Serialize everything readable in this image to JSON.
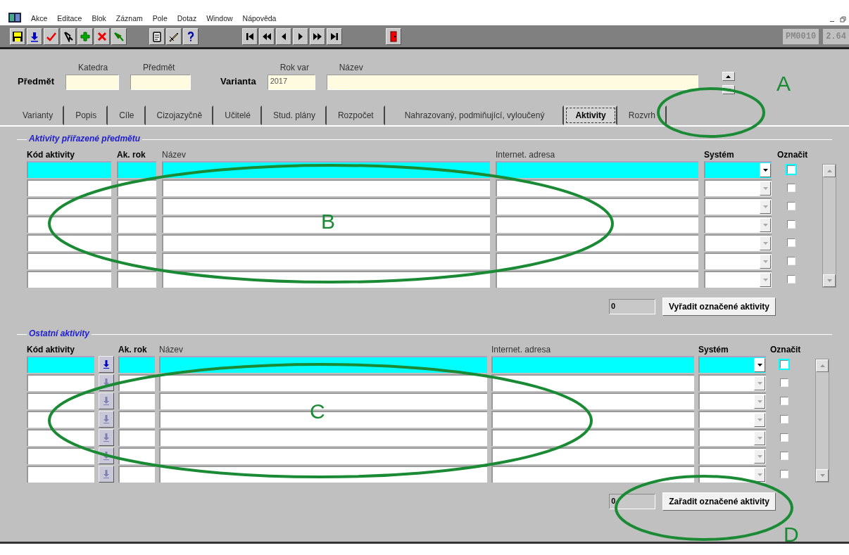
{
  "menu": [
    "Akce",
    "Editace",
    "Blok",
    "Záznam",
    "Pole",
    "Dotaz",
    "Window",
    "Nápověda"
  ],
  "toolbar": {
    "form_id": "PM0010",
    "version": "2.64"
  },
  "header": {
    "groups": [
      {
        "label": "Předmět",
        "fields": [
          {
            "label": "Katedra"
          },
          {
            "label": "Předmět"
          }
        ]
      },
      {
        "label": "Varianta",
        "fields": [
          {
            "label": "Rok var",
            "value": "2017"
          },
          {
            "label": "Název"
          }
        ]
      }
    ]
  },
  "tabs": [
    {
      "label": "Varianty",
      "selected": false
    },
    {
      "label": "Popis",
      "selected": false
    },
    {
      "label": "Cíle",
      "selected": false
    },
    {
      "label": "Cizojazyčně",
      "selected": false
    },
    {
      "label": "Učitelé",
      "selected": false
    },
    {
      "label": "Stud. plány",
      "selected": false
    },
    {
      "label": "Rozpočet",
      "selected": false
    },
    {
      "label": "Nahrazovaný, podmiňující, vyloučený",
      "selected": false
    },
    {
      "label": "Aktivity",
      "selected": true
    },
    {
      "label": "Rozvrh",
      "selected": false
    }
  ],
  "sections": [
    {
      "title": "Aktivity přiřazené předmětu",
      "columns": [
        {
          "label": "Kód aktivity",
          "kind": "text",
          "bold": true
        },
        {
          "label": "Ak. rok",
          "kind": "text",
          "bold": true
        },
        {
          "label": "Název",
          "kind": "text",
          "bold": false
        },
        {
          "label": "Internet. adresa",
          "kind": "text",
          "bold": false
        },
        {
          "label": "Systém",
          "kind": "dropdown",
          "bold": true
        },
        {
          "label": "Označit",
          "kind": "checkbox",
          "bold": true
        }
      ],
      "rows": [
        {
          "selected": true,
          "checked": false
        },
        {
          "selected": false,
          "checked": false
        },
        {
          "selected": false,
          "checked": false
        },
        {
          "selected": false,
          "checked": false
        },
        {
          "selected": false,
          "checked": false
        },
        {
          "selected": false,
          "checked": false
        },
        {
          "selected": false,
          "checked": false
        }
      ],
      "count": "0",
      "button": "Vyřadit označené aktivity"
    },
    {
      "title": "Ostatní aktivity",
      "columns": [
        {
          "label": "Kód aktivity",
          "kind": "text",
          "bold": true
        },
        {
          "kind": "lov"
        },
        {
          "label": "Ak. rok",
          "kind": "text",
          "bold": true
        },
        {
          "label": "Název",
          "kind": "text",
          "bold": false
        },
        {
          "label": "Internet. adresa",
          "kind": "text",
          "bold": false
        },
        {
          "label": "Systém",
          "kind": "dropdown",
          "bold": true
        },
        {
          "label": "Označit",
          "kind": "checkbox",
          "bold": true
        }
      ],
      "rows": [
        {
          "selected": true,
          "checked": false
        },
        {
          "selected": false,
          "checked": false
        },
        {
          "selected": false,
          "checked": false
        },
        {
          "selected": false,
          "checked": false
        },
        {
          "selected": false,
          "checked": false
        },
        {
          "selected": false,
          "checked": false
        },
        {
          "selected": false,
          "checked": false
        }
      ],
      "count": "0",
      "button": "Zařadit označené aktivity"
    }
  ],
  "annotations": [
    {
      "label": "A"
    },
    {
      "label": "B"
    },
    {
      "label": "C"
    },
    {
      "label": "D"
    }
  ]
}
